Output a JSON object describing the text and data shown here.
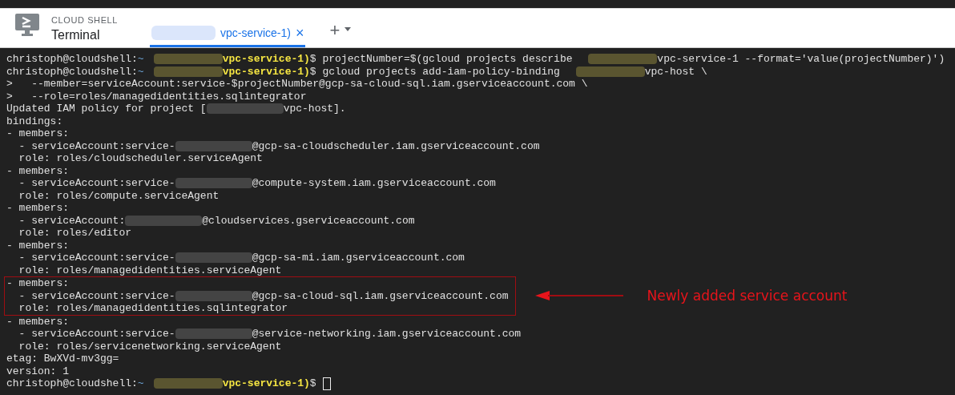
{
  "header": {
    "product": "CLOUD SHELL",
    "title": "Terminal",
    "tab": {
      "label": "vpc-service-1)",
      "close": "×",
      "selected": true
    },
    "add": "+"
  },
  "terminal": {
    "blocks": [
      {
        "highlighted": false,
        "lines": [
          [
            {
              "kind": "plain",
              "text": "christoph@cloudshell:"
            },
            {
              "kind": "path",
              "text": "~"
            },
            {
              "kind": "redacted"
            },
            {
              "kind": "project",
              "text": "vpc-service-1)"
            },
            {
              "kind": "plain",
              "text": "$ projectNumber=$(gcloud projects describe "
            },
            {
              "kind": "redacted"
            },
            {
              "kind": "plain",
              "text": "vpc-service-1 --format='value(projectNumber)')"
            }
          ],
          [
            {
              "kind": "plain",
              "text": "christoph@cloudshell:"
            },
            {
              "kind": "path",
              "text": "~"
            },
            {
              "kind": "redacted"
            },
            {
              "kind": "project",
              "text": "vpc-service-1)"
            },
            {
              "kind": "plain",
              "text": "$ gcloud projects add-iam-policy-binding "
            },
            {
              "kind": "redacted"
            },
            {
              "kind": "plain",
              "text": "vpc-host \\"
            }
          ],
          [
            {
              "kind": "plain",
              "text": ">   --member=serviceAccount:service-$projectNumber@gcp-sa-cloud-sql.iam.gserviceaccount.com \\"
            }
          ],
          [
            {
              "kind": "plain",
              "text": ">   --role=roles/managedidentities.sqlintegrator"
            }
          ],
          [
            {
              "kind": "plain",
              "text": "Updated IAM policy for project ["
            },
            {
              "kind": "redacted"
            },
            {
              "kind": "plain",
              "text": "vpc-host]."
            }
          ],
          [
            {
              "kind": "plain",
              "text": "bindings:"
            }
          ],
          [
            {
              "kind": "plain",
              "text": "- members:"
            }
          ],
          [
            {
              "kind": "plain",
              "text": "  - serviceAccount:service-"
            },
            {
              "kind": "redacted"
            },
            {
              "kind": "plain",
              "text": "@gcp-sa-cloudscheduler.iam.gserviceaccount.com"
            }
          ],
          [
            {
              "kind": "plain",
              "text": "  role: roles/cloudscheduler.serviceAgent"
            }
          ],
          [
            {
              "kind": "plain",
              "text": "- members:"
            }
          ],
          [
            {
              "kind": "plain",
              "text": "  - serviceAccount:service-"
            },
            {
              "kind": "redacted"
            },
            {
              "kind": "plain",
              "text": "@compute-system.iam.gserviceaccount.com"
            }
          ],
          [
            {
              "kind": "plain",
              "text": "  role: roles/compute.serviceAgent"
            }
          ],
          [
            {
              "kind": "plain",
              "text": "- members:"
            }
          ],
          [
            {
              "kind": "plain",
              "text": "  - serviceAccount:"
            },
            {
              "kind": "redacted"
            },
            {
              "kind": "plain",
              "text": "@cloudservices.gserviceaccount.com"
            }
          ],
          [
            {
              "kind": "plain",
              "text": "  role: roles/editor"
            }
          ],
          [
            {
              "kind": "plain",
              "text": "- members:"
            }
          ],
          [
            {
              "kind": "plain",
              "text": "  - serviceAccount:service-"
            },
            {
              "kind": "redacted"
            },
            {
              "kind": "plain",
              "text": "@gcp-sa-mi.iam.gserviceaccount.com"
            }
          ],
          [
            {
              "kind": "plain",
              "text": "  role: roles/managedidentities.serviceAgent"
            }
          ]
        ]
      },
      {
        "highlighted": true,
        "annotation": "Newly added service account",
        "lines": [
          [
            {
              "kind": "plain",
              "text": "- members:"
            }
          ],
          [
            {
              "kind": "plain",
              "text": "  - serviceAccount:service-"
            },
            {
              "kind": "redacted"
            },
            {
              "kind": "plain",
              "text": "@gcp-sa-cloud-sql.iam.gserviceaccount.com"
            }
          ],
          [
            {
              "kind": "plain",
              "text": "  role: roles/managedidentities.sqlintegrator"
            }
          ]
        ]
      },
      {
        "highlighted": false,
        "lines": [
          [
            {
              "kind": "plain",
              "text": "- members:"
            }
          ],
          [
            {
              "kind": "plain",
              "text": "  - serviceAccount:service-"
            },
            {
              "kind": "redacted"
            },
            {
              "kind": "plain",
              "text": "@service-networking.iam.gserviceaccount.com"
            }
          ],
          [
            {
              "kind": "plain",
              "text": "  role: roles/servicenetworking.serviceAgent"
            }
          ],
          [
            {
              "kind": "plain",
              "text": "etag: BwXVd-mv3gg="
            }
          ],
          [
            {
              "kind": "plain",
              "text": "version: 1"
            }
          ],
          [
            {
              "kind": "plain",
              "text": "christoph@cloudshell:"
            },
            {
              "kind": "path",
              "text": "~"
            },
            {
              "kind": "redacted"
            },
            {
              "kind": "project",
              "text": "vpc-service-1)"
            },
            {
              "kind": "plain",
              "text": "$"
            },
            {
              "kind": "cursor"
            }
          ]
        ]
      }
    ]
  }
}
